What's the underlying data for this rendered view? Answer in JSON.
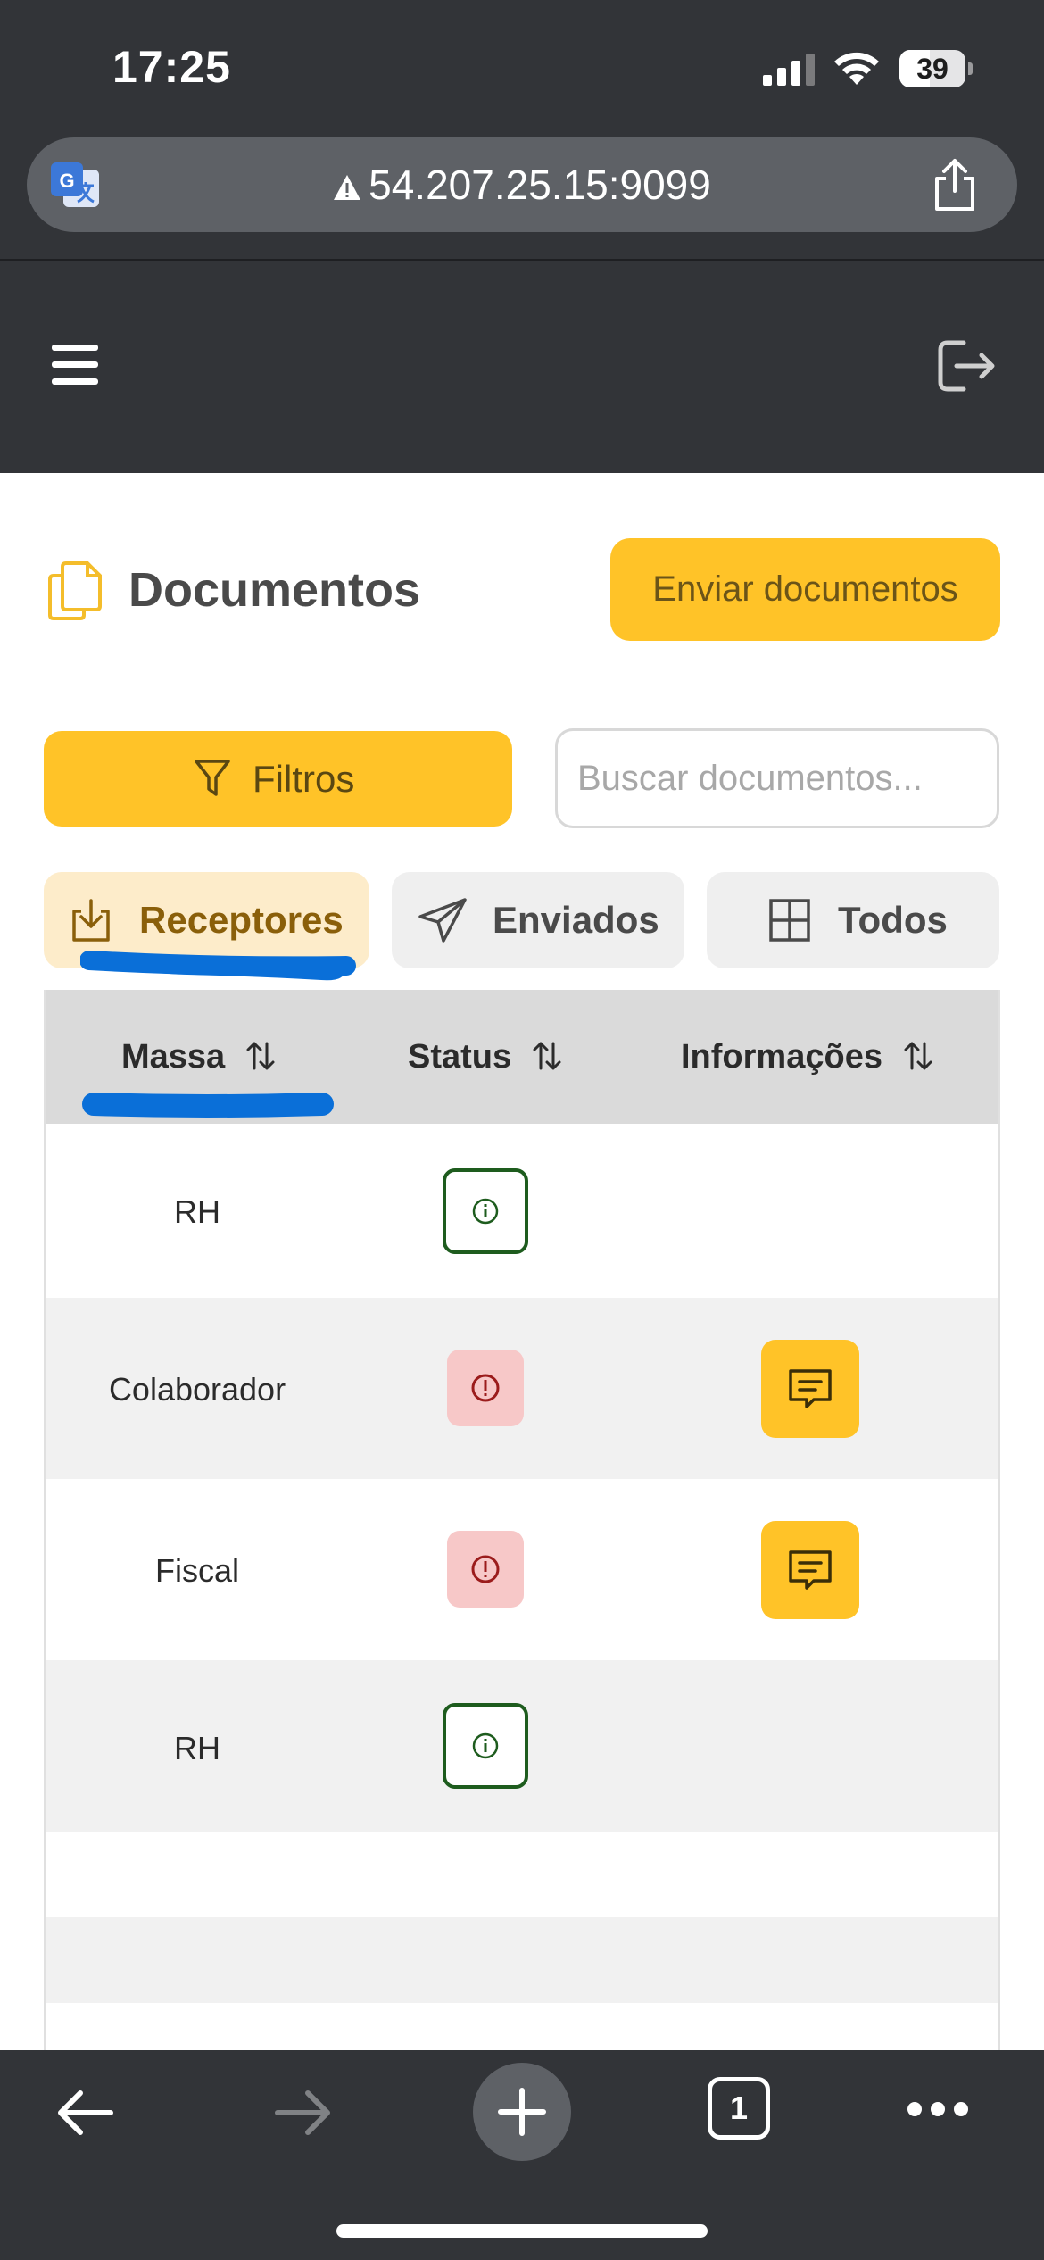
{
  "status_bar": {
    "time": "17:25",
    "battery": "39"
  },
  "browser": {
    "url": "54.207.25.15:9099",
    "tab_count": "1"
  },
  "page": {
    "title": "Documentos",
    "send_button": "Enviar documentos",
    "filter_button": "Filtros",
    "search_placeholder": "Buscar documentos..."
  },
  "tabs": [
    {
      "label": "Receptores",
      "icon": "download-icon",
      "active": true
    },
    {
      "label": "Enviados",
      "icon": "send-icon",
      "active": false
    },
    {
      "label": "Todos",
      "icon": "grid-icon",
      "active": false
    }
  ],
  "table": {
    "columns": [
      "Massa",
      "Status",
      "Informações"
    ],
    "rows": [
      {
        "massa": "RH",
        "status": "info",
        "has_info": false
      },
      {
        "massa": "Colaborador",
        "status": "error",
        "has_info": true
      },
      {
        "massa": "Fiscal",
        "status": "error",
        "has_info": true
      },
      {
        "massa": "RH",
        "status": "info",
        "has_info": false
      },
      {
        "massa": "",
        "status": "",
        "has_info": false
      },
      {
        "massa": "",
        "status": "",
        "has_info": false
      }
    ]
  },
  "colors": {
    "accent": "#ffc328",
    "header_bg": "#323438",
    "active_tab_bg": "#fdecca",
    "status_ok": "#1e5c1e",
    "status_error_bg": "#f7c8c8",
    "annotation_blue": "#0a6fd8"
  }
}
